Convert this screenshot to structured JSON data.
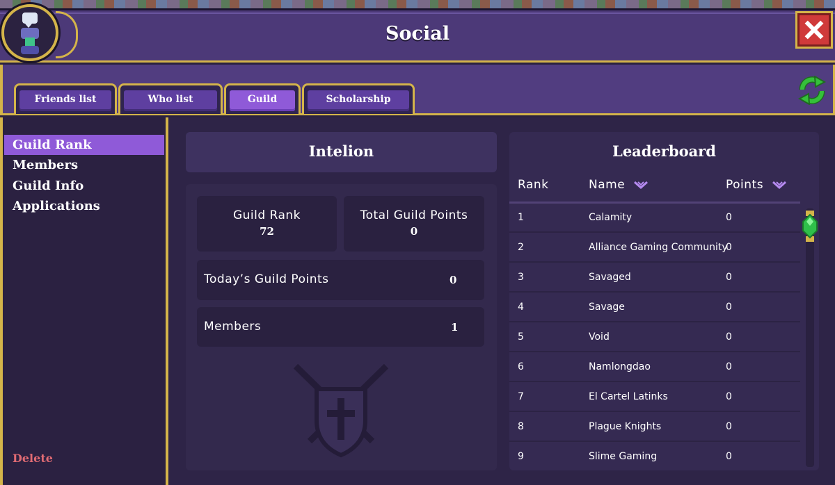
{
  "window": {
    "title": "Social"
  },
  "tabs": [
    {
      "label": "Friends list",
      "active": false
    },
    {
      "label": "Who list",
      "active": false
    },
    {
      "label": "Guild",
      "active": true
    },
    {
      "label": "Scholarship",
      "active": false
    }
  ],
  "sidebar": {
    "items": [
      {
        "label": "Guild Rank",
        "active": true
      },
      {
        "label": "Members",
        "active": false
      },
      {
        "label": "Guild Info",
        "active": false
      },
      {
        "label": "Applications",
        "active": false
      }
    ],
    "delete_label": "Delete"
  },
  "guild": {
    "name": "Intelion",
    "rank_label": "Guild Rank",
    "rank_value": "72",
    "total_points_label": "Total Guild Points",
    "total_points_value": "0",
    "today_points_label": "Today’s Guild Points",
    "today_points_value": "0",
    "members_label": "Members",
    "members_value": "1"
  },
  "leaderboard": {
    "title": "Leaderboard",
    "columns": {
      "rank": "Rank",
      "name": "Name",
      "points": "Points"
    },
    "rows": [
      {
        "rank": "1",
        "name": "Calamity",
        "points": "0"
      },
      {
        "rank": "2",
        "name": "Alliance Gaming Community",
        "points": "0"
      },
      {
        "rank": "3",
        "name": "Savaged",
        "points": "0"
      },
      {
        "rank": "4",
        "name": "Savage",
        "points": "0"
      },
      {
        "rank": "5",
        "name": "Void",
        "points": "0"
      },
      {
        "rank": "6",
        "name": "Namlongdao",
        "points": "0"
      },
      {
        "rank": "7",
        "name": "El Cartel Latinks",
        "points": "0"
      },
      {
        "rank": "8",
        "name": "Plague Knights",
        "points": "0"
      },
      {
        "rank": "9",
        "name": "Slime Gaming",
        "points": "0"
      }
    ]
  },
  "colors": {
    "frame_gold": "#d4b44a",
    "panel_purple": "#4c3978",
    "active_tab": "#8f5ad8",
    "delete_red": "#e06b73",
    "close_red": "#d03a3a",
    "refresh_green": "#35c03a"
  },
  "icons": {
    "emblem": "social-emblem-icon",
    "close": "close-icon",
    "refresh": "refresh-icon",
    "sort": "chevron-down-icon",
    "crest": "guild-crest-icon",
    "scroll": "scroll-thumb-gem"
  }
}
